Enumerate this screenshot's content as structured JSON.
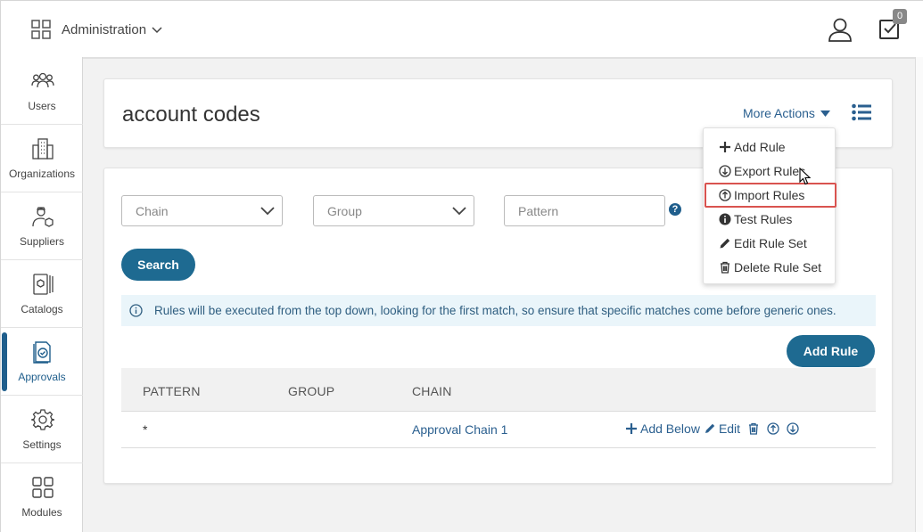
{
  "header": {
    "app_title": "Administration",
    "task_count": "0"
  },
  "sidebar": {
    "items": [
      {
        "label": "Users",
        "icon": "users-icon"
      },
      {
        "label": "Organizations",
        "icon": "organizations-icon"
      },
      {
        "label": "Suppliers",
        "icon": "suppliers-icon"
      },
      {
        "label": "Catalogs",
        "icon": "catalogs-icon"
      },
      {
        "label": "Approvals",
        "icon": "approvals-icon"
      },
      {
        "label": "Settings",
        "icon": "gear-icon"
      },
      {
        "label": "Modules",
        "icon": "modules-icon"
      }
    ],
    "active": "Approvals"
  },
  "page": {
    "title": "account codes",
    "more_actions_label": "More Actions"
  },
  "more_actions_menu": {
    "items": [
      {
        "label": "Add Rule",
        "icon": "plus-icon"
      },
      {
        "label": "Export Rules",
        "icon": "arrow-down-circle-icon"
      },
      {
        "label": "Import Rules",
        "icon": "arrow-up-circle-icon",
        "highlighted": true
      },
      {
        "label": "Test Rules",
        "icon": "info-circle-icon"
      },
      {
        "label": "Edit Rule Set",
        "icon": "pencil-icon"
      },
      {
        "label": "Delete Rule Set",
        "icon": "trash-icon"
      }
    ]
  },
  "filters": {
    "chain_placeholder": "Chain",
    "group_placeholder": "Group",
    "pattern_placeholder": "Pattern",
    "search_label": "Search"
  },
  "info_message": "Rules will be executed from the top down, looking for the first match, so ensure that specific matches come before generic ones.",
  "add_rule_label": "Add Rule",
  "table": {
    "columns": [
      "PATTERN",
      "GROUP",
      "CHAIN"
    ],
    "rows": [
      {
        "pattern": "*",
        "group": "",
        "chain": "Approval Chain 1"
      }
    ],
    "row_actions": {
      "add_below": "Add Below",
      "edit": "Edit"
    }
  },
  "colors": {
    "primary": "#1e6a91",
    "link": "#2a5f8f",
    "highlight_border": "#d9534f",
    "info_bg": "#eaf5fa"
  }
}
